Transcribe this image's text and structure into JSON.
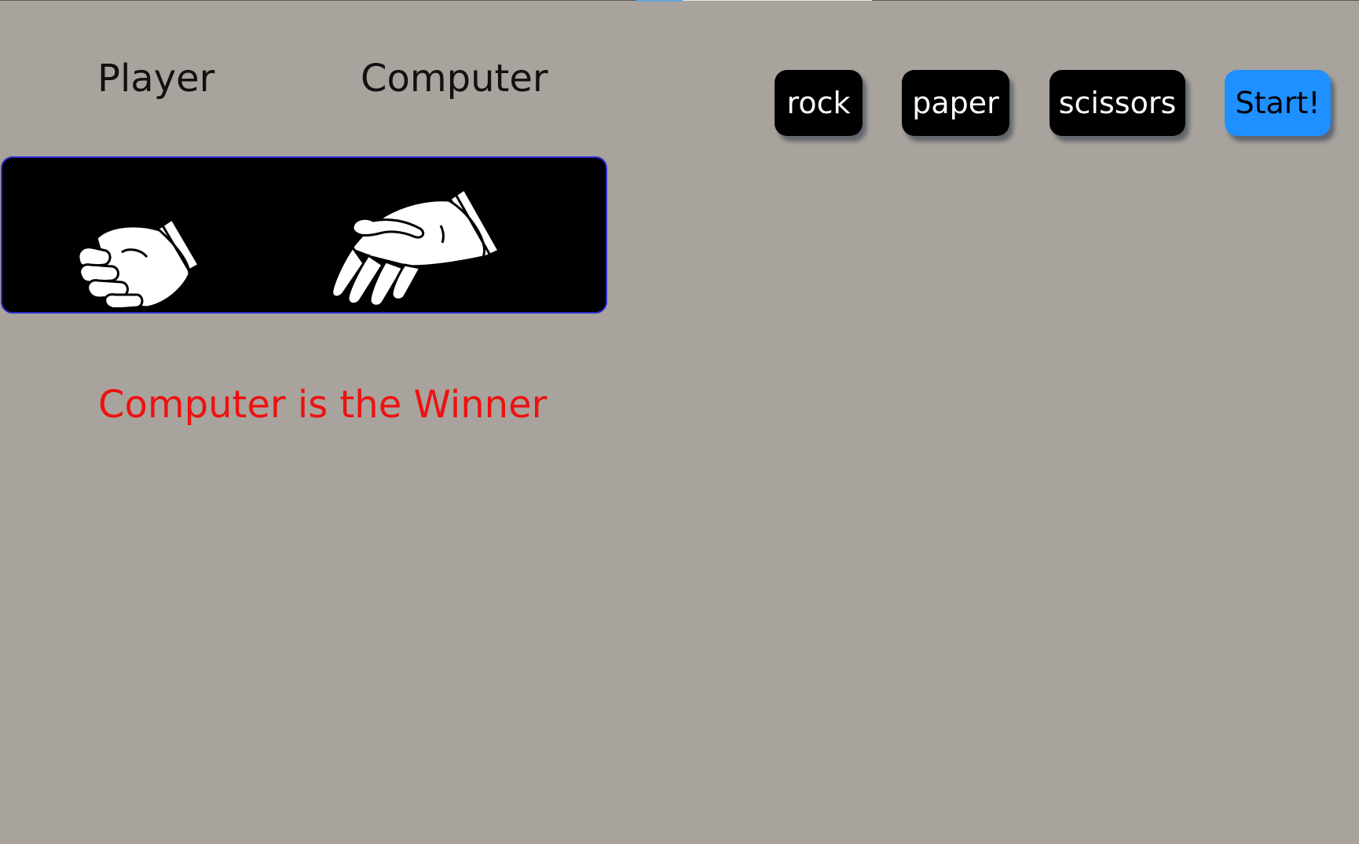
{
  "scoreboard": {
    "player_label": "Player",
    "computer_label": "Computer"
  },
  "controls": {
    "rock_label": "rock",
    "paper_label": "paper",
    "scissors_label": "scissors",
    "start_label": "Start!"
  },
  "arena": {
    "player_choice_icon": "rock-fist-icon",
    "computer_choice_icon": "paper-open-hand-icon"
  },
  "result": {
    "message": "Computer is the Winner"
  },
  "colors": {
    "background": "#a8a49d",
    "button": "#000000",
    "start_button": "#1e90ff",
    "arena_border": "#2d2ad0",
    "result_text": "#ee1111"
  }
}
